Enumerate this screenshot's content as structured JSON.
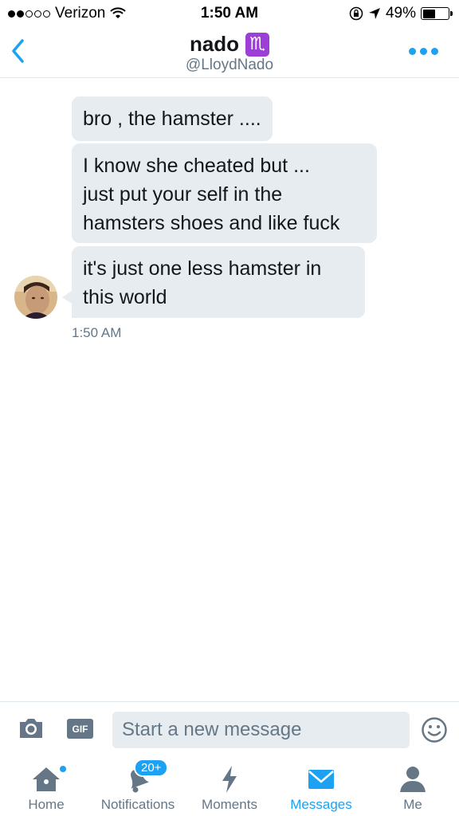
{
  "status_bar": {
    "carrier": "Verizon",
    "time": "1:50 AM",
    "battery": "49%",
    "battery_level": 0.49
  },
  "header": {
    "name": "nado",
    "zodiac_glyph": "♏",
    "handle": "@LloydNado"
  },
  "messages": [
    {
      "text": "bro , the hamster ...."
    },
    {
      "lines": [
        "I know she cheated but ...",
        "just put your self in the",
        "hamsters shoes and like fuck"
      ]
    },
    {
      "lines": [
        "it's just one less hamster in",
        "this world"
      ]
    }
  ],
  "timestamp": "1:50 AM",
  "compose": {
    "gif_label": "GIF",
    "placeholder": "Start a new message"
  },
  "tabs": [
    {
      "label": "Home",
      "icon": "home-icon"
    },
    {
      "label": "Notifications",
      "icon": "bell-icon",
      "badge": "20+"
    },
    {
      "label": "Moments",
      "icon": "lightning-icon"
    },
    {
      "label": "Messages",
      "icon": "envelope-icon",
      "active": true
    },
    {
      "label": "Me",
      "icon": "person-icon"
    }
  ],
  "colors": {
    "accent": "#1da1f2",
    "bubble": "#e6ecf0",
    "secondary_text": "#657786",
    "zodiac_bg": "#9b3fd6"
  }
}
